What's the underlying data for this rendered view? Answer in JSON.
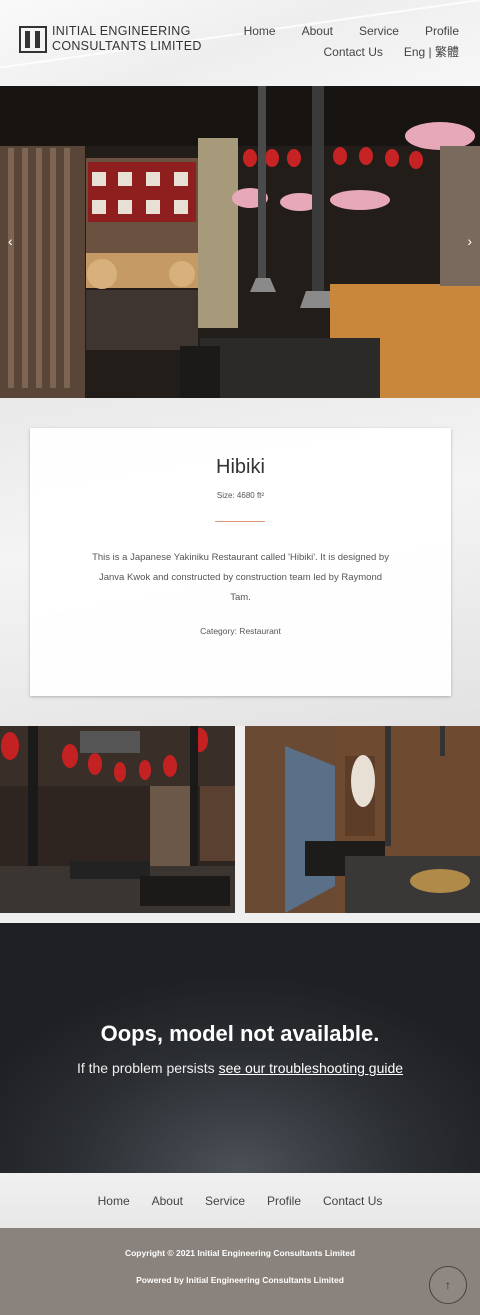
{
  "header": {
    "logo_line1": "INITIAL ENGINEERING",
    "logo_line2": "CONSULTANTS LIMITED",
    "nav": {
      "home": "Home",
      "about": "About",
      "service": "Service",
      "profile": "Profile",
      "contact": "Contact Us",
      "lang": "Eng | 繁體"
    }
  },
  "hero": {
    "prev_icon": "chevron-left-icon",
    "next_icon": "chevron-right-icon",
    "prev_glyph": "‹",
    "next_glyph": "›"
  },
  "project": {
    "title": "Hibiki",
    "size": "Size: 4680 ft²",
    "description": "This is a Japanese Yakiniku Restaurant called 'Hibiki'. It is designed by Janva Kwok and constructed by construction team led by Raymond Tam.",
    "category": "Category: Restaurant"
  },
  "model_error": {
    "title": "Oops, model not available.",
    "sub_prefix": "If the problem persists ",
    "sub_link": "see our troubleshooting guide"
  },
  "footer": {
    "nav": {
      "home": "Home",
      "about": "About",
      "service": "Service",
      "profile": "Profile",
      "contact": "Contact Us"
    },
    "copyright": "Copyright © 2021 Initial Engineering Consultants Limited",
    "powered": "Powered by Initial Engineering Consultants Limited",
    "to_top_glyph": "↑"
  },
  "colors": {
    "accent": "#e09878",
    "footer_bg": "#8a827c",
    "model_bg": "#2b2e32"
  }
}
